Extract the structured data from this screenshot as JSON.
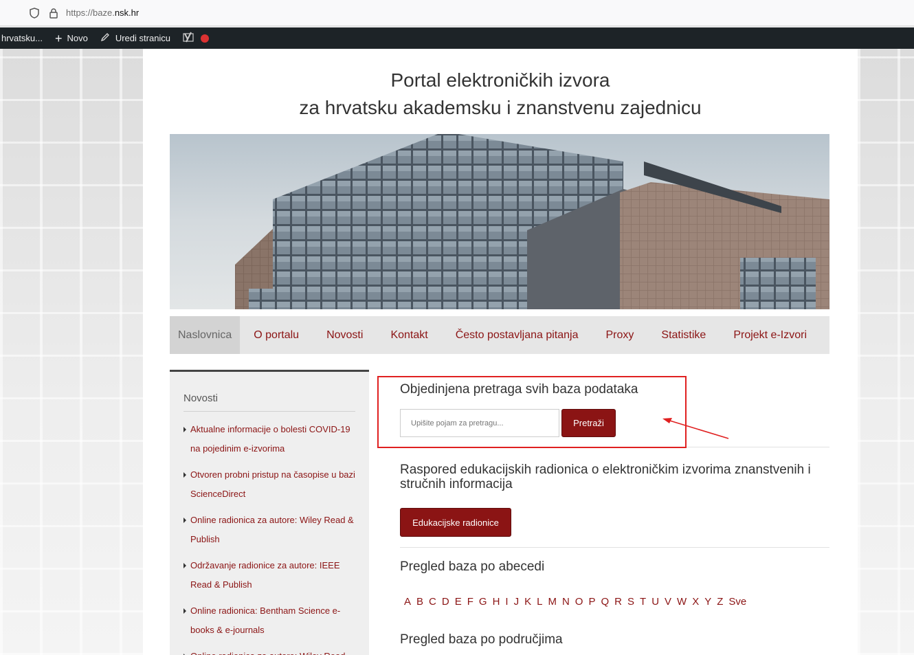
{
  "browser": {
    "url_prefix": "https://baze.",
    "url_domain": "nsk.hr"
  },
  "adminbar": {
    "site": "hrvatsku...",
    "new_label": "Novo",
    "edit_label": "Uredi stranicu"
  },
  "header": {
    "title_line1": "Portal elektroničkih izvora",
    "title_line2": "za hrvatsku akademsku i znanstvenu zajednicu"
  },
  "nav": {
    "items": [
      "Naslovnica",
      "O portalu",
      "Novosti",
      "Kontakt",
      "Često postavljana pitanja",
      "Proxy",
      "Statistike",
      "Projekt e-Izvori"
    ]
  },
  "sidebar": {
    "title": "Novosti",
    "items": [
      "Aktualne informacije o bolesti COVID-19 na pojedinim e-izvorima",
      "Otvoren probni pristup na časopise u bazi ScienceDirect",
      "Online radionica za autore: Wiley Read & Publish",
      "Održavanje radionice za autore: IEEE Read & Publish",
      "Online radionica: Bentham Science e-books & e-journals",
      "Online radionica za autore: Wiley Read"
    ]
  },
  "main": {
    "search_title": "Objedinjena pretraga svih baza podataka",
    "search_placeholder": "Upišite pojam za pretragu...",
    "search_button": "Pretraži",
    "edu_title": "Raspored edukacijskih radionica o elektroničkim izvorima znanstvenih i stručnih informacija",
    "edu_button": "Edukacijske radionice",
    "abc_title": "Pregled baza po abecedi",
    "letters": [
      "A",
      "B",
      "C",
      "D",
      "E",
      "F",
      "G",
      "H",
      "I",
      "J",
      "K",
      "L",
      "M",
      "N",
      "O",
      "P",
      "Q",
      "R",
      "S",
      "T",
      "U",
      "V",
      "W",
      "X",
      "Y",
      "Z",
      "Sve"
    ],
    "areas_title": "Pregled baza po područjima"
  },
  "colors": {
    "accent": "#8b1414",
    "adminbar": "#1d2327",
    "annotation": "#e02020"
  }
}
